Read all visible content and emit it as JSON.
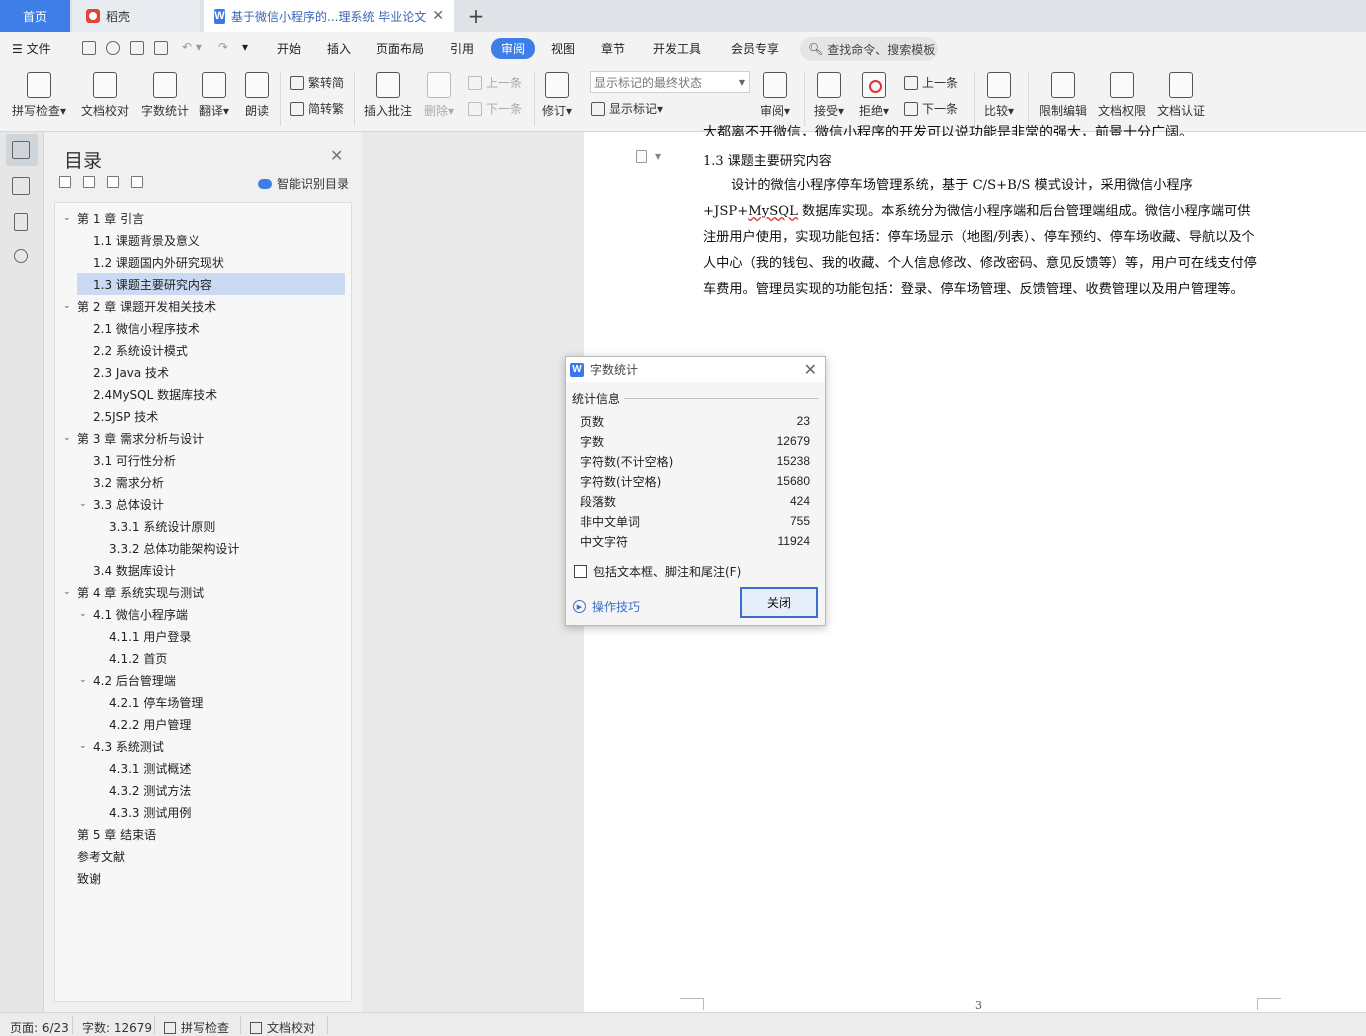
{
  "tabs": {
    "home": "首页",
    "daoke": "稻壳",
    "doc": "基于微信小程序的...理系统 毕业论文",
    "close_glyph": "✕",
    "new_glyph": "+"
  },
  "menu": {
    "file": "文件",
    "items": [
      "开始",
      "插入",
      "页面布局",
      "引用",
      "审阅",
      "视图",
      "章节",
      "开发工具",
      "会员专享"
    ],
    "active": "审阅",
    "search_placeholder": "查找命令、搜索模板"
  },
  "ribbon": {
    "spell_check": "拼写检查",
    "doc_proof": "文档校对",
    "word_count": "字数统计",
    "translate": "翻译",
    "read_aloud": "朗读",
    "trad_to_simp": "繁转简",
    "simp_to_trad": "简转繁",
    "insert_comment": "插入批注",
    "delete": "删除",
    "prev_comment": "上一条",
    "next_comment": "下一条",
    "track_changes": "修订",
    "markup_state": "显示标记的最终状态",
    "show_markup": "显示标记",
    "review": "审阅",
    "accept": "接受",
    "reject": "拒绝",
    "prev_change": "上一条",
    "next_change": "下一条",
    "compare": "比较",
    "restrict_edit": "限制编辑",
    "doc_permission": "文档权限",
    "doc_certify": "文档认证",
    "dropdown_glyph": "▾"
  },
  "toc": {
    "title": "目录",
    "close_glyph": "✕",
    "smart_label": "智能识别目录",
    "items": [
      {
        "text": "第 1 章  引言",
        "level": 0,
        "caret": "⌄"
      },
      {
        "text": "1.1  课题背景及意义",
        "level": 1,
        "caret": ""
      },
      {
        "text": "1.2  课题国内外研究现状",
        "level": 1,
        "caret": ""
      },
      {
        "text": "1.3  课题主要研究内容",
        "level": 1,
        "caret": "",
        "selected": true
      },
      {
        "text": "第 2 章  课题开发相关技术",
        "level": 0,
        "caret": "⌄"
      },
      {
        "text": "2.1  微信小程序技术",
        "level": 1,
        "caret": ""
      },
      {
        "text": "2.2  系统设计模式",
        "level": 1,
        "caret": ""
      },
      {
        "text": "2.3 Java 技术",
        "level": 1,
        "caret": ""
      },
      {
        "text": "2.4MySQL 数据库技术",
        "level": 1,
        "caret": ""
      },
      {
        "text": "2.5JSP 技术",
        "level": 1,
        "caret": ""
      },
      {
        "text": "第 3 章  需求分析与设计",
        "level": 0,
        "caret": "⌄"
      },
      {
        "text": "3.1  可行性分析",
        "level": 1,
        "caret": ""
      },
      {
        "text": "3.2  需求分析",
        "level": 1,
        "caret": ""
      },
      {
        "text": "3.3  总体设计",
        "level": 1,
        "caret": "⌄"
      },
      {
        "text": "3.3.1  系统设计原则",
        "level": 2,
        "caret": ""
      },
      {
        "text": "3.3.2  总体功能架构设计",
        "level": 2,
        "caret": ""
      },
      {
        "text": "3.4  数据库设计",
        "level": 1,
        "caret": ""
      },
      {
        "text": "第 4 章  系统实现与测试",
        "level": 0,
        "caret": "⌄"
      },
      {
        "text": "4.1  微信小程序端",
        "level": 1,
        "caret": "⌄"
      },
      {
        "text": "4.1.1  用户登录",
        "level": 2,
        "caret": ""
      },
      {
        "text": "4.1.2 首页",
        "level": 2,
        "caret": ""
      },
      {
        "text": "4.2  后台管理端",
        "level": 1,
        "caret": "⌄"
      },
      {
        "text": "4.2.1  停车场管理",
        "level": 2,
        "caret": ""
      },
      {
        "text": "4.2.2  用户管理",
        "level": 2,
        "caret": ""
      },
      {
        "text": "4.3  系统测试",
        "level": 1,
        "caret": "⌄"
      },
      {
        "text": "4.3.1  测试概述",
        "level": 2,
        "caret": ""
      },
      {
        "text": "4.3.2  测试方法",
        "level": 2,
        "caret": ""
      },
      {
        "text": "4.3.3  测试用例",
        "level": 2,
        "caret": ""
      },
      {
        "text": "第 5 章  结束语",
        "level": 0,
        "caret": ""
      },
      {
        "text": "参考文献",
        "level": 0,
        "caret": ""
      },
      {
        "text": "致谢",
        "level": 0,
        "caret": ""
      }
    ]
  },
  "document": {
    "prev_line": "大都离不开微信，微信小程序的开发可以说功能是非常的强大，前景十分广阔。",
    "heading": "1.3  课题主要研究内容",
    "para_part1": "设计的微信小程序停车场管理系统，基于 C/S+B/S 模式设计，采用微信小程序 +JSP+",
    "para_wavy": "MySQL",
    "para_part2": " 数据库实现。本系统分为微信小程序端和后台管理端组成。微信小程序端可供注册用户使用，实现功能包括：停车场显示（地图/列表）、停车预约、停车场收藏、导航以及个人中心（我的钱包、我的收藏、个人信息修改、修改密码、意见反馈等）等，用户可在线支付停车费用。管理员实现的功能包括：登录、停车场管理、反馈管理、收费管理以及用户管理等。",
    "page_number": "3"
  },
  "dialog": {
    "title": "字数统计",
    "close_glyph": "✕",
    "section": "统计信息",
    "stats": [
      {
        "label": "页数",
        "value": "23"
      },
      {
        "label": "字数",
        "value": "12679"
      },
      {
        "label": "字符数(不计空格)",
        "value": "15238"
      },
      {
        "label": "字符数(计空格)",
        "value": "15680"
      },
      {
        "label": "段落数",
        "value": "424"
      },
      {
        "label": "非中文单词",
        "value": "755"
      },
      {
        "label": "中文字符",
        "value": "11924"
      }
    ],
    "include_label": "包括文本框、脚注和尾注(F)",
    "include_checked": false,
    "tips_label": "操作技巧",
    "close_button": "关闭"
  },
  "statusbar": {
    "page": "页面: 6/23",
    "words": "字数: 12679",
    "spell_check": "拼写检查",
    "doc_proof": "文档校对"
  }
}
